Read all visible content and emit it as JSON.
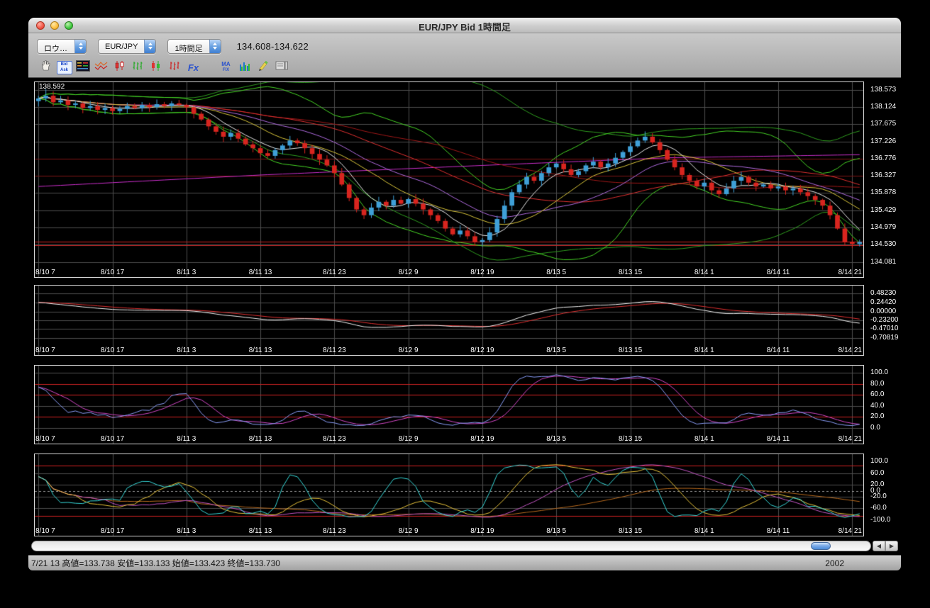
{
  "window": {
    "title": "EUR/JPY Bid 1時間足"
  },
  "toolbar": {
    "chart_type_select": "ロウ…",
    "symbol_select": "EUR/JPY",
    "timeframe_select": "1時間足",
    "quote": "134.608-134.622",
    "icons": {
      "bid": "Bid",
      "ask": "Ask",
      "fx": "Fx",
      "ma": "MA",
      "fix": "FIX"
    },
    "icon_names": [
      "hand-tool",
      "bid-ask",
      "price-board",
      "zigzag-lines",
      "candlesticks-red",
      "hlc-bars-green",
      "candles-mixed",
      "bars-red",
      "fx-options",
      "ma-fix",
      "compare-bars",
      "draw-pencil",
      "scale-box"
    ]
  },
  "scrollbar": {
    "left_arrow": "◀",
    "right_arrow": "▶"
  },
  "status_bar": {
    "info": "7/21 13 高値=133.738 安値=133.133 始値=133.423 終値=133.730",
    "year": "2002"
  },
  "chart_data": {
    "type": "candlestick",
    "title": "EUR/JPY Bid 1時間足",
    "bars": 112,
    "x_label_every": 10,
    "x_labels": [
      "8/10 7",
      "8/10 17",
      "8/11 3",
      "8/11 13",
      "8/11 23",
      "8/12 9",
      "8/12 19",
      "8/13 5",
      "8/13 15",
      "8/14 1",
      "8/14 11",
      "8/14 21"
    ],
    "colors": {
      "up": "#3fa0d8",
      "down": "#d8251f",
      "grid": "#4d4d4d",
      "red_line": "#cc2222",
      "dark_red": "#801616"
    },
    "candles": {
      "open_first": 138.28,
      "high_override": [
        1,
        138.592
      ],
      "closes": [
        138.35,
        138.42,
        138.25,
        138.3,
        138.18,
        138.22,
        138.1,
        138.15,
        138.05,
        138.1,
        138.02,
        138.08,
        138.15,
        138.1,
        138.18,
        138.12,
        138.2,
        138.15,
        138.22,
        138.18,
        138.12,
        137.95,
        137.8,
        137.62,
        137.48,
        137.35,
        137.45,
        137.3,
        137.15,
        137.05,
        136.92,
        136.85,
        137.0,
        137.12,
        137.25,
        137.18,
        137.05,
        136.9,
        136.75,
        136.6,
        136.4,
        136.1,
        135.75,
        135.45,
        135.3,
        135.5,
        135.65,
        135.55,
        135.7,
        135.6,
        135.72,
        135.6,
        135.45,
        135.3,
        135.15,
        134.95,
        134.8,
        134.9,
        134.75,
        134.6,
        134.65,
        134.85,
        135.2,
        135.55,
        135.9,
        136.1,
        136.3,
        136.2,
        136.4,
        136.55,
        136.65,
        136.5,
        136.35,
        136.45,
        136.6,
        136.7,
        136.55,
        136.65,
        136.8,
        136.95,
        137.1,
        137.25,
        137.35,
        137.2,
        137.0,
        136.75,
        136.55,
        136.35,
        136.2,
        136.05,
        136.15,
        135.95,
        135.85,
        136.0,
        136.2,
        136.3,
        136.15,
        136.05,
        136.1,
        136.0,
        136.05,
        135.95,
        136.0,
        135.9,
        135.8,
        135.7,
        135.55,
        135.3,
        134.95,
        134.6,
        134.55,
        134.6
      ]
    },
    "panels": [
      {
        "id": "price",
        "annotation": "138.592",
        "y_min": 133.98,
        "y_max": 138.7,
        "y_labels": [
          "138.573",
          "138.124",
          "137.675",
          "137.226",
          "136.776",
          "136.327",
          "135.878",
          "135.429",
          "134.979",
          "134.530",
          "134.081"
        ],
        "grid_gray": [
          138.573,
          138.124,
          137.675,
          137.226,
          136.776,
          136.327,
          135.878,
          135.429,
          134.979,
          134.53,
          134.081
        ],
        "dark_red_levels": [
          136.776,
          136.327
        ],
        "red_levels": [
          134.615,
          134.525
        ],
        "candles": true,
        "series": [
          {
            "type": "bb_upper",
            "period": 45,
            "mult": 2,
            "color": "#2f9e1f",
            "width": 1
          },
          {
            "type": "bb_lower",
            "period": 45,
            "mult": 2,
            "color": "#2f9e1f",
            "width": 1
          },
          {
            "type": "bb_upper",
            "period": 20,
            "mult": 2,
            "color": "#46d525",
            "width": 1
          },
          {
            "type": "bb_lower",
            "period": 20,
            "mult": 2,
            "color": "#46d525",
            "width": 1
          },
          {
            "type": "points",
            "points": [
              [
                0,
                136.05
              ],
              [
                30,
                136.35
              ],
              [
                60,
                136.6
              ],
              [
                85,
                136.8
              ],
              [
                111,
                136.88
              ]
            ],
            "color": "#cc2fcc",
            "width": 1
          },
          {
            "type": "sma",
            "period": 55,
            "color": "#a01818",
            "width": 1
          },
          {
            "type": "sma",
            "period": 34,
            "color": "#e03030",
            "width": 1
          },
          {
            "type": "sma",
            "period": 21,
            "color": "#b06be0",
            "width": 1
          },
          {
            "type": "sma",
            "period": 13,
            "color": "#d8c43a",
            "width": 1
          },
          {
            "type": "sma",
            "period": 6,
            "color": "#e8e8e8",
            "width": 1
          }
        ]
      },
      {
        "id": "macd",
        "y_min": -0.86,
        "y_max": 0.62,
        "y_labels": [
          "0.48230",
          "0.24420",
          "0.00000",
          "-0.23200",
          "-0.47010",
          "-0.70819"
        ],
        "grid_gray": [
          0.4823,
          0.2442,
          0,
          -0.232,
          -0.4701,
          -0.70819
        ],
        "series": [
          {
            "type": "macd_signal",
            "fast": 12,
            "slow": 26,
            "signal": 9,
            "seed_offset": 0.35,
            "gain": 0.75,
            "color": "#e03030",
            "width": 1
          },
          {
            "type": "macd",
            "fast": 12,
            "slow": 26,
            "seed_offset": 0.35,
            "gain": 0.75,
            "color": "#f2f2f2",
            "width": 1
          }
        ]
      },
      {
        "id": "stoch",
        "y_min": -8,
        "y_max": 108,
        "y_labels": [
          "100.0",
          "80.0",
          "60.0",
          "40.0",
          "20.0",
          "0.0"
        ],
        "grid_gray": [
          100,
          40,
          0
        ],
        "red_levels": [
          80,
          60,
          20
        ],
        "series": [
          {
            "type": "stoch",
            "period": 14,
            "smooth": 3,
            "smooth2": 5,
            "color": "#d448c8",
            "width": 1
          },
          {
            "type": "stoch",
            "period": 14,
            "smooth": 3,
            "color": "#8a9df8",
            "width": 1
          }
        ]
      },
      {
        "id": "osc",
        "y_min": -115,
        "y_max": 115,
        "y_labels": [
          "100.0",
          "60.0",
          "20.0",
          "0.0",
          "-20.0",
          "-60.0",
          "-100.0"
        ],
        "grid_gray": [
          60,
          20,
          -20,
          -60
        ],
        "red_levels": [
          85,
          -85
        ],
        "zero_dashed": true,
        "series": [
          {
            "type": "stoch",
            "period": 89,
            "smooth": 21,
            "scale": 200,
            "color": "#b86a1e",
            "width": 1
          },
          {
            "type": "stoch",
            "period": 34,
            "smooth": 10,
            "scale": 200,
            "color": "#c455c4",
            "width": 1
          },
          {
            "type": "stoch",
            "period": 10,
            "smooth": 6,
            "scale": 200,
            "color": "#e8c33a",
            "width": 1
          },
          {
            "type": "stoch",
            "period": 5,
            "smooth": 2,
            "scale": 200,
            "color": "#36d8d8",
            "width": 1
          }
        ]
      }
    ]
  }
}
